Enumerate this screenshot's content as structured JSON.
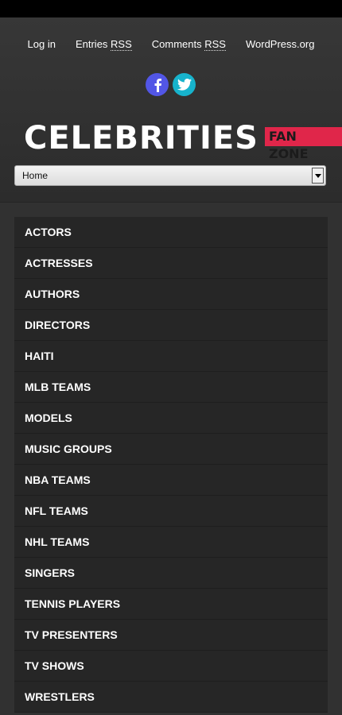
{
  "meta": {
    "login": "Log in",
    "entries_prefix": "Entries ",
    "entries_abbr": "RSS",
    "comments_prefix": "Comments ",
    "comments_abbr": "RSS",
    "wordpress": "WordPress.org"
  },
  "social": {
    "facebook_icon": "facebook-icon",
    "twitter_icon": "twitter-icon"
  },
  "logo": {
    "main": "CELEBRITIES",
    "badge": "FAN ZONE"
  },
  "nav_select": {
    "selected": "Home"
  },
  "categories": [
    "ACTORS",
    "ACTRESSES",
    "AUTHORS",
    "DIRECTORS",
    "HAITI",
    "MLB TEAMS",
    "MODELS",
    "MUSIC GROUPS",
    "NBA TEAMS",
    "NFL TEAMS",
    "NHL TEAMS",
    "SINGERS",
    "TENNIS PLAYERS",
    "TV PRESENTERS",
    "TV SHOWS",
    "WRESTLERS"
  ],
  "colors": {
    "facebook": "#5256e6",
    "twitter": "#17b3cc",
    "badge": "#e0264a"
  }
}
